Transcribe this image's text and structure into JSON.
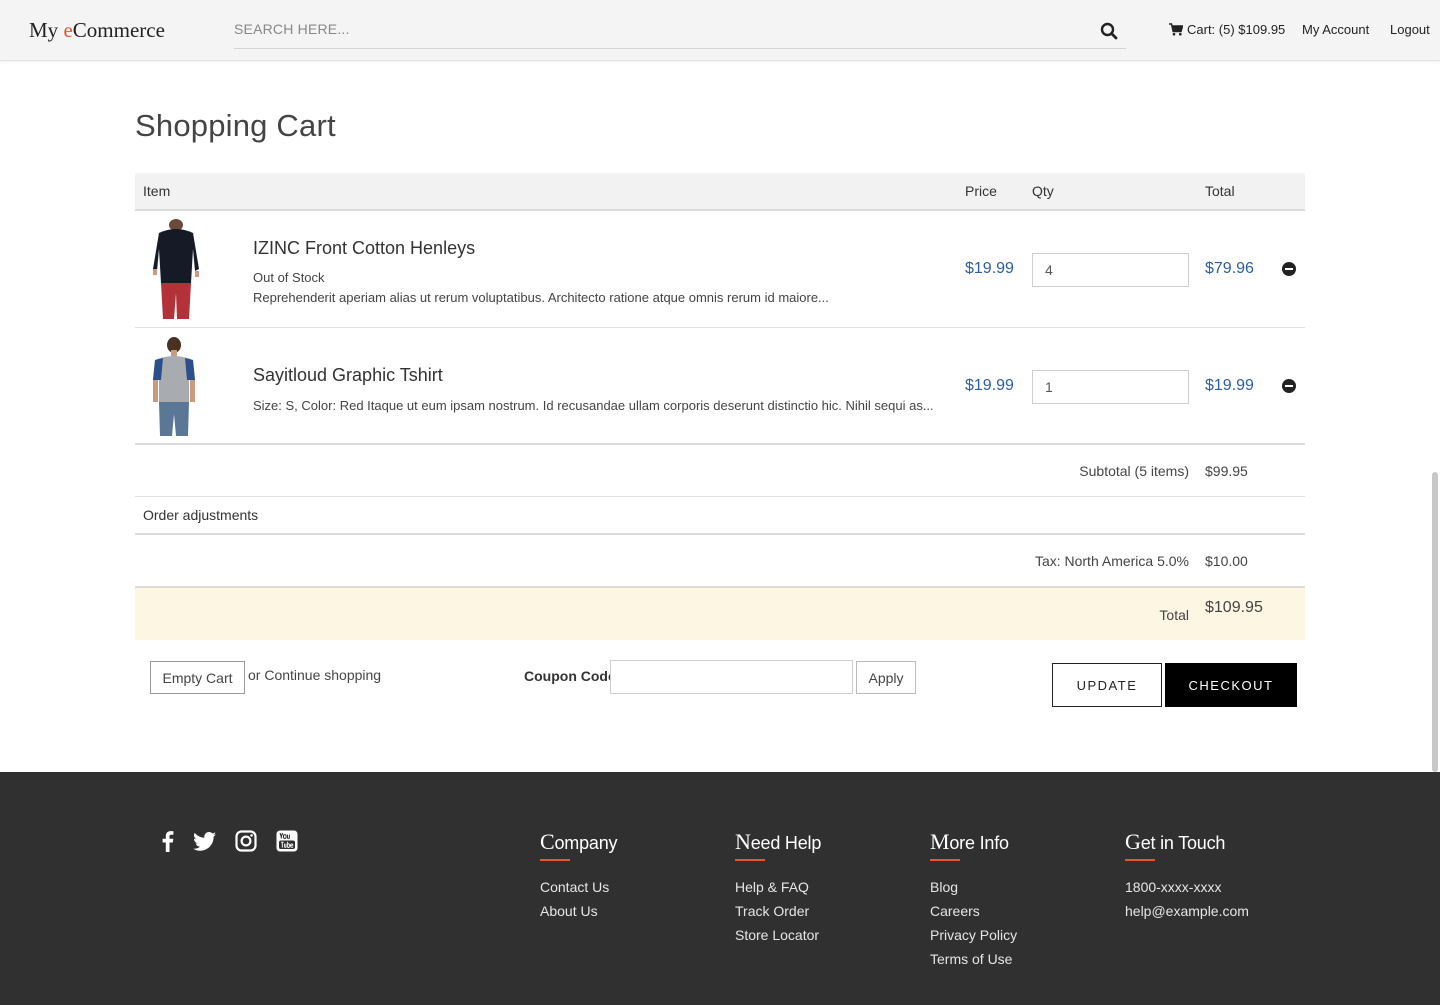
{
  "header": {
    "logo_prefix": "My ",
    "logo_accent": "e",
    "logo_suffix": "Commerce",
    "search_placeholder": "SEARCH HERE...",
    "cart_label": "Cart: (5) $109.95",
    "account_label": "My Account",
    "logout_label": "Logout"
  },
  "page_title": "Shopping Cart",
  "table": {
    "headers": {
      "item": "Item",
      "price": "Price",
      "qty": "Qty",
      "total": "Total"
    },
    "rows": [
      {
        "name": "IZINC Front Cotton Henleys",
        "stock": "Out of Stock",
        "description": "Reprehenderit aperiam alias ut rerum voluptatibus. Architecto ratione atque omnis rerum id maiore...",
        "price": "$19.99",
        "qty": "4",
        "total": "$79.96"
      },
      {
        "name": "Sayitloud Graphic Tshirt",
        "description": "Size: S, Color: Red Itaque ut eum ipsam nostrum. Id recusandae ullam corporis deserunt distinctio hic. Nihil sequi as...",
        "price": "$19.99",
        "qty": "1",
        "total": "$19.99"
      }
    ]
  },
  "summary": {
    "subtotal_label": "Subtotal (5 items)",
    "subtotal_value": "$99.95",
    "adjustments_label": "Order adjustments",
    "tax_label": "Tax: North America 5.0%",
    "tax_value": "$10.00",
    "total_label": "Total",
    "total_value": "$109.95"
  },
  "actions": {
    "empty_cart": "Empty Cart",
    "continue_shopping": "or Continue shopping",
    "coupon_label": "Coupon Code",
    "apply": "Apply",
    "update": "UPDATE",
    "checkout": "CHECKOUT"
  },
  "footer": {
    "social_icons": [
      "facebook-icon",
      "twitter-icon",
      "instagram-icon",
      "youtube-icon"
    ],
    "columns": [
      {
        "head_cap": "C",
        "head_rest": "ompany",
        "links": [
          "Contact Us",
          "About Us"
        ]
      },
      {
        "head_cap": "N",
        "head_rest": "eed Help",
        "links": [
          "Help & FAQ",
          "Track Order",
          "Store Locator"
        ]
      },
      {
        "head_cap": "M",
        "head_rest": "ore Info",
        "links": [
          "Blog",
          "Careers",
          "Privacy Policy",
          "Terms of Use"
        ]
      },
      {
        "head_cap": "G",
        "head_rest": "et in Touch",
        "links": [
          "1800-xxxx-xxxx",
          "help@example.com"
        ]
      }
    ]
  },
  "colors": {
    "accent": "#e8552d",
    "price_blue": "#2b5f9e",
    "total_highlight": "#fcf6e3",
    "footer_bg": "#303030",
    "checkout_bg": "#000000"
  }
}
